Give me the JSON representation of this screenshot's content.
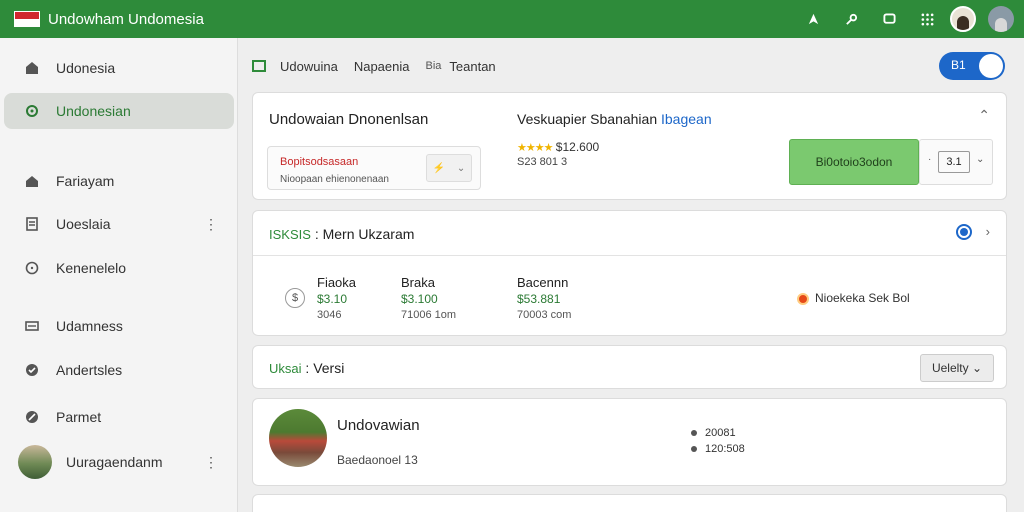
{
  "app": {
    "title": "Undowham Undomesia"
  },
  "sidebar": {
    "items": [
      {
        "label": "Udonesia",
        "icon": "home-icon"
      },
      {
        "label": "Undonesian",
        "icon": "settings-icon"
      },
      {
        "label": "Fariayam",
        "icon": "house-icon"
      },
      {
        "label": "Uoeslaia",
        "icon": "document-icon"
      },
      {
        "label": "Kenenelelo",
        "icon": "clock-icon"
      },
      {
        "label": "Udamness",
        "icon": "card-icon"
      },
      {
        "label": "Andertsles",
        "icon": "shield-icon"
      },
      {
        "label": "Parmet",
        "icon": "edit-icon"
      },
      {
        "label": "Uuragaendanm",
        "icon": "avatar"
      }
    ]
  },
  "breadcrumb": {
    "items": [
      "Udowuina",
      "Napaenia",
      "Bia",
      "Teantan"
    ]
  },
  "toggle": {
    "label": "B1"
  },
  "card1": {
    "title": "Undowaian Dnonenlsan",
    "right_title": "Veskuapier Sbanahian",
    "right_link": "Ibagean",
    "select_label": "Bopitsodsasaan",
    "select_sub": "Nioopaan ehienonenaan",
    "rating_value": "$12.600",
    "rating_sub": "S23 801 3",
    "green_button": "Bi0otoio3odon",
    "stepper_value": "3.1"
  },
  "card2": {
    "tag": "ISKSIS",
    "title": "Mern Ukzaram",
    "columns": [
      {
        "label": "Fiaoka",
        "price": "$3.10",
        "sub": "3046"
      },
      {
        "label": "Braka",
        "price": "$3.100",
        "sub": "71006 1om"
      },
      {
        "label": "Bacennn",
        "price": "$53.881",
        "sub": "70003 com"
      }
    ],
    "alert": "Nioekeka Sek Bol"
  },
  "card3": {
    "tag": "Uksai",
    "title": "Versi",
    "button": "Uelelty"
  },
  "card4": {
    "title": "Undovawian",
    "sub": "Baedaonoel 13",
    "stats": [
      "20081",
      "120:508"
    ]
  }
}
